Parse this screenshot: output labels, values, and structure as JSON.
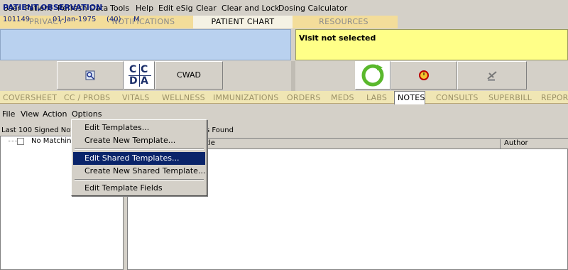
{
  "menubar": [
    "User",
    "Patient",
    "Refresh Data",
    "Tools",
    "Help",
    "Edit eSig",
    "Clear",
    "Clear and Lock",
    "Dosing Calculator"
  ],
  "top_tabs": [
    "PRIVACY",
    "NOTIFICATIONS",
    "PATIENT CHART",
    "RESOURCES"
  ],
  "patient": {
    "name": "PATIENT,OBSERVATION",
    "id": "101149",
    "dob": "01-Jan-1975",
    "age": "(40)",
    "sex": "M"
  },
  "visit": {
    "status": "Visit not selected"
  },
  "toolbar": {
    "cwad_label": "CWAD",
    "ccda_letters": [
      "C",
      "C",
      "D",
      "A"
    ]
  },
  "chart_tabs": [
    "COVERSHEET",
    "CC / PROBS",
    "VITALS",
    "WELLNESS",
    "IMMUNIZATIONS",
    "ORDERS",
    "MEDS",
    "LABS",
    "NOTES",
    "CONSULTS",
    "SUPERBILL",
    "REPOR"
  ],
  "active_chart_tab": "NOTES",
  "notes_menu": [
    "File",
    "View",
    "Action",
    "Options"
  ],
  "left_panel": {
    "header": "Last 100 Signed Note",
    "tree_item": "No Matching"
  },
  "right_panel": {
    "header": "s Found",
    "columns": [
      "tle",
      "Author"
    ]
  },
  "options_menu": {
    "items": [
      "Edit Templates...",
      "Create New Template...",
      "Edit Shared Templates...",
      "Create New Shared Template...",
      "Edit Template Fields"
    ],
    "highlighted": "Edit Shared Templates..."
  },
  "colors": {
    "patient_bg": "#b9d1ef",
    "visit_bg": "#ffff88",
    "highlight": "#0a246a"
  }
}
